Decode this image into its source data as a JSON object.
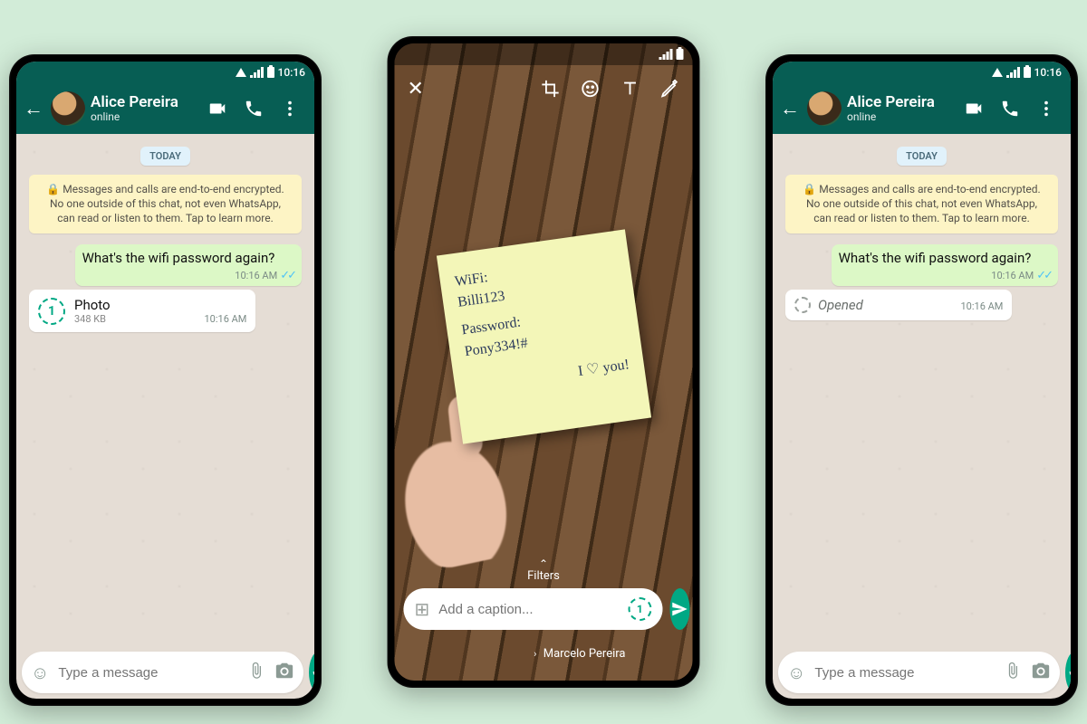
{
  "status": {
    "time": "10:16"
  },
  "chat": {
    "contact_name": "Alice Pereira",
    "presence": "online",
    "day_label": "TODAY",
    "e2e_notice": "🔒 Messages and calls are end-to-end encrypted. No one outside of this chat, not even WhatsApp, can read or listen to them. Tap to learn more.",
    "out_msg": {
      "text": "What's the wifi password again?",
      "time": "10:16 AM"
    },
    "viewonce_photo": {
      "label": "Photo",
      "size": "348 KB",
      "time": "10:16 AM"
    },
    "viewonce_opened": {
      "label": "Opened",
      "time": "10:16 AM"
    },
    "input_placeholder": "Type a message"
  },
  "editor": {
    "filters_label": "Filters",
    "caption_placeholder": "Add a caption...",
    "recipient": "Marcelo Pereira",
    "note": {
      "line1": "WiFi:",
      "line2": "Billi123",
      "line3": "Password:",
      "line4": "Pony334!#",
      "line5": "I ♡ you!"
    }
  }
}
